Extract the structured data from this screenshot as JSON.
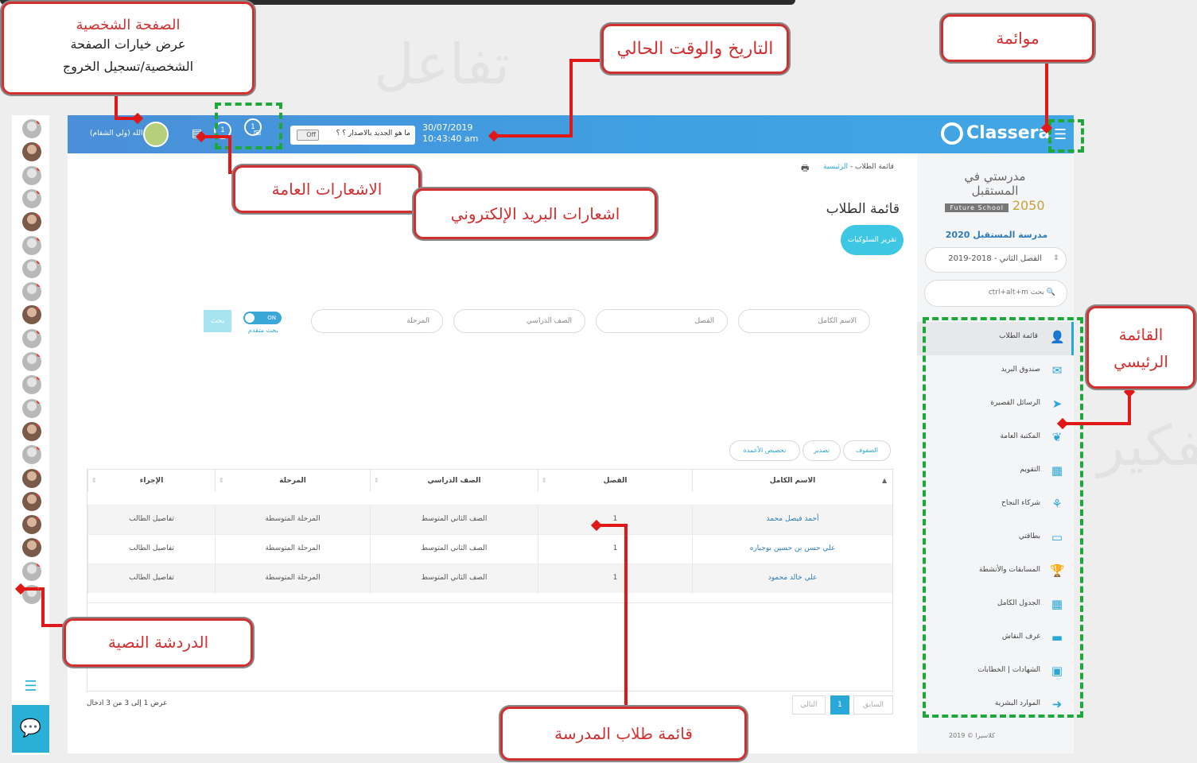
{
  "header": {
    "user_name": "عبدالله (ولي الشقام)",
    "notif_general_count": "1",
    "notif_mail_count": "1",
    "whats_new": "ما هو الجديد بالاصدار ؟ ؟",
    "toggle": "Off",
    "date": "30/07/2019",
    "time": "10:43:40 am",
    "logo": "Classera"
  },
  "sidebar": {
    "school_logo_line": "مدرستي في المستقبل",
    "school_logo_sub": "Future School",
    "school_logo_year": "2050",
    "school_name": "مدرسة المستقبل 2020",
    "semester": "الفصل الثاني - 2018-2019",
    "search_placeholder": "ctrl+alt+m بحث",
    "items": [
      {
        "label": "قائمة الطلاب",
        "icon": "user-icon"
      },
      {
        "label": "صندوق البريد",
        "icon": "envelope-icon"
      },
      {
        "label": "الرسائل القصيرة",
        "icon": "paper-plane-icon"
      },
      {
        "label": "المكتبة العامة",
        "icon": "leaf-icon"
      },
      {
        "label": "التقويم",
        "icon": "calendar-icon"
      },
      {
        "label": "شركاء النجاح",
        "icon": "partners-icon"
      },
      {
        "label": "بطاقتي",
        "icon": "card-icon"
      },
      {
        "label": "المسابقات والأنشطة",
        "icon": "trophy-icon"
      },
      {
        "label": "الجدول الكامل",
        "icon": "table-icon"
      },
      {
        "label": "غرف النقاش",
        "icon": "chat-icon"
      },
      {
        "label": "الشهادات | الخطابات",
        "icon": "qr-icon"
      },
      {
        "label": "الموارد البشرية",
        "icon": "signout-icon"
      }
    ],
    "copyright": "كلاسيرا © 2019"
  },
  "main": {
    "breadcrumb_home": "الرئيسية",
    "breadcrumb_sep": " - ",
    "breadcrumb_current": "قائمة الطلاب",
    "title": "قائمة الطلاب",
    "behaviors_button": "تقرير السلوكيات",
    "filters": {
      "fullname": "الاسم الكامل",
      "section": "الفصل",
      "grade": "الصف الدراسي",
      "stage": "المرحلة"
    },
    "advanced_toggle": "ON",
    "advanced_label": "بحث متقدم",
    "search_button": "بحث",
    "table_buttons": {
      "rows": "الصفوف",
      "export": "تصدير",
      "customize": "تخصيص الأعمدة"
    },
    "columns": [
      "الاسم الكامل",
      "الفصل",
      "الصف الدراسي",
      "المرحلة",
      "الإجراء"
    ],
    "rows": [
      {
        "name": "أحمد فيصل محمد",
        "section": "1",
        "grade": "الصف الثاني المتوسط",
        "stage": "المرحلة المتوسطة",
        "action": "تفاصيل الطالب"
      },
      {
        "name": "علي حسن بن حسين بوجباره",
        "section": "1",
        "grade": "الصف الثاني المتوسط",
        "stage": "المرحلة المتوسطة",
        "action": "تفاصيل الطالب"
      },
      {
        "name": "علي خالد محمود",
        "section": "1",
        "grade": "الصف الثاني المتوسط",
        "stage": "المرحلة المتوسطة",
        "action": "تفاصيل الطالب"
      }
    ],
    "info": "عرض 1 إلى 3 من 3 ادخال",
    "pager": {
      "prev": "السابق",
      "page": "1",
      "next": "التالي"
    }
  },
  "annotations": {
    "profile_title": "الصفحة الشخصية",
    "profile_line1": "عرض خيارات الصفحة",
    "profile_line2": "الشخصية/تسجيل الخروج",
    "datetime": "التاريخ والوقت الحالي",
    "menu": "موائمة",
    "general_notifs": "الاشعارات العامة",
    "mail_notifs": "اشعارات البريد الإلكتروني",
    "main_menu_1": "القائمة",
    "main_menu_2": "الرئيسي",
    "chat": "الدردشة النصية",
    "students": "قائمة طلاب المدرسة"
  },
  "colors": {
    "header": "#42a6e4",
    "accent": "#2aa7d9",
    "annotation": "#d23030",
    "dash": "#1fa83a"
  }
}
